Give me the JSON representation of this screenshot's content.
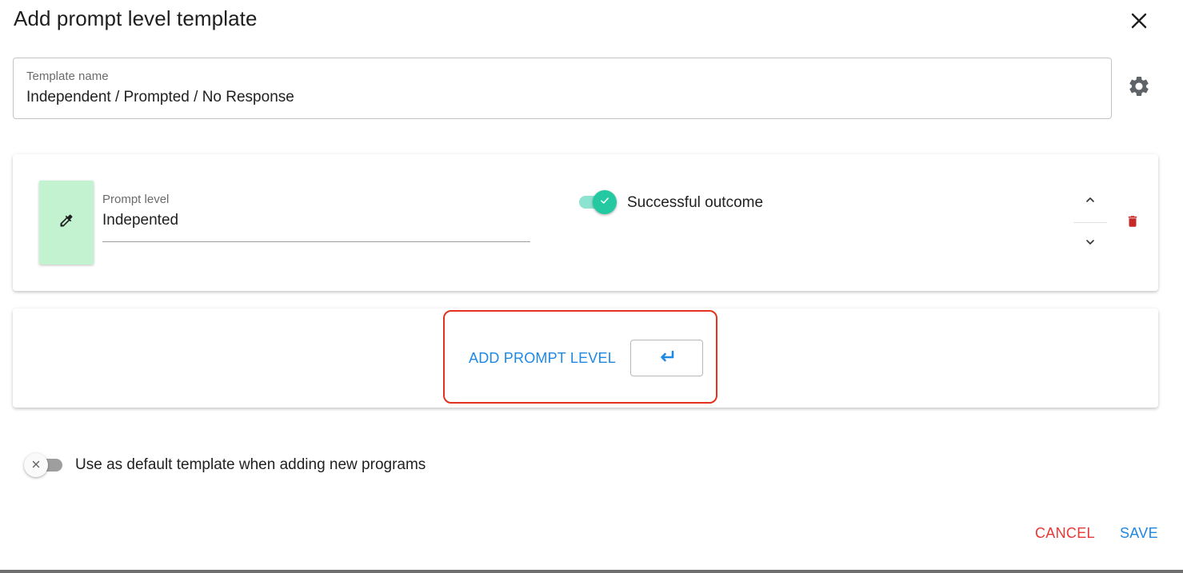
{
  "dialog": {
    "title": "Add prompt level template"
  },
  "template_name": {
    "label": "Template name",
    "value": "Independent / Prompted / No Response"
  },
  "prompt_levels": [
    {
      "label": "Prompt level",
      "value": "Indepented",
      "color": "#c2f2cf",
      "successful_outcome_label": "Successful outcome",
      "successful_outcome_on": true
    }
  ],
  "add_prompt_level": {
    "label": "ADD PROMPT LEVEL",
    "shortcut_icon": "enter-key-icon"
  },
  "default_template": {
    "label": "Use as default template when adding new programs",
    "on": false
  },
  "actions": {
    "cancel_label": "CANCEL",
    "save_label": "SAVE"
  },
  "icons": {
    "close": "close-icon",
    "settings": "gear-icon",
    "color_picker": "eyedropper-icon",
    "move_up": "chevron-up-icon",
    "move_down": "chevron-down-icon",
    "delete": "trash-icon"
  },
  "colors": {
    "accent_teal": "#25c9a1",
    "primary_blue": "#1e88e5",
    "danger_red": "#e53935",
    "delete_red": "#c62828",
    "highlight_red": "#e5321f"
  }
}
